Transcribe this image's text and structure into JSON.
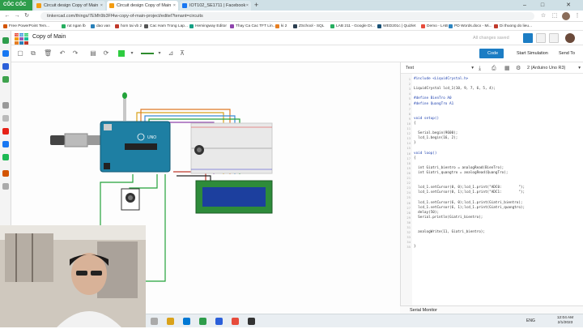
{
  "browser": {
    "brand": "CỐC CỐC",
    "tabs": [
      {
        "label": "Circuit design Copy of Main",
        "active": false
      },
      {
        "label": "Circuit design Copy of Main",
        "active": true
      },
      {
        "label": "IOT102_SE1711 | Facebook",
        "active": false
      }
    ],
    "new_tab": "+",
    "url": "tinkercad.com/things/7EMh9b3Ff4w-copy-of-main-project/editel?tenant=circuits",
    "bookmarks": [
      "Free PowerPoint Tem...",
      "rut ngan lb",
      "dao van",
      "hom tai vb 2",
      "Cac Ham Trong Lap...",
      "Hemingway Editor",
      "Thay Ca Cac TFT Lin...",
      "ki 2",
      "ZSchool - SQL",
      "LAB 211 - Google Dr...",
      "WED201c | Quizlet",
      "Demo - LAB",
      "PD Words.docx - Mi...",
      "Di thuong do lieu..."
    ]
  },
  "app": {
    "project_title": "Copy of Main",
    "save_status": "All changes saved",
    "logo_letters": [
      "TIN",
      "KER",
      "CAD",
      ""
    ]
  },
  "toolbar": {
    "code_label": "Code",
    "start_sim_label": "Start Simulation",
    "send_label": "Send To",
    "color_swatch": "#2ecc40",
    "wire_color": "#2e8b2e"
  },
  "code": {
    "mode": "Text",
    "board": "2 (Arduino Uno R3)",
    "lines": [
      "#include <LiquidCrystal.h>",
      "",
      "LiquidCrystal lcd_1(10, 9, 7, 6, 5, 4);",
      "",
      "#define BienTro A0",
      "#define QuangTro A1",
      "",
      "",
      "void setup()",
      "{",
      "",
      "  Serial.begin(9600);",
      "  lcd_1.begin(16, 2);",
      "}",
      "",
      "void loop()",
      "{",
      "",
      "  int Giatri_bientro = analogRead(BienTro);",
      "  int Giatri_quangtro = analogRead(QuangTro);",
      "",
      "",
      "  lcd_1.setCursor(0, 0);lcd_1.print(\"ADC0:        \");",
      "  lcd_1.setCursor(0, 1);lcd_1.print(\"ADC1:        \");",
      "",
      "  lcd_1.setCursor(6, 0);lcd_1.print(Giatri_bientro);",
      "  lcd_1.setCursor(6, 1);lcd_1.print(Giatri_quangtro);",
      "  delay(50);",
      "  Serial.println(Giatri_bientro);",
      "",
      "",
      "  analogWrite(11, Giatri_bientro);",
      "",
      "",
      "}"
    ]
  },
  "serial_monitor_label": "Serial Monitor",
  "arduino_label": "UNO",
  "taskbar": {
    "lang": "ENG",
    "time": "12:04 AM",
    "date": "2/1/2023"
  },
  "colors": {
    "accent": "#1c7dc4",
    "arduino": "#1e7fa3",
    "lcd": "#1c3f9e",
    "lcd_board": "#2e8b3a",
    "brand_green": "#2e9d4b"
  }
}
